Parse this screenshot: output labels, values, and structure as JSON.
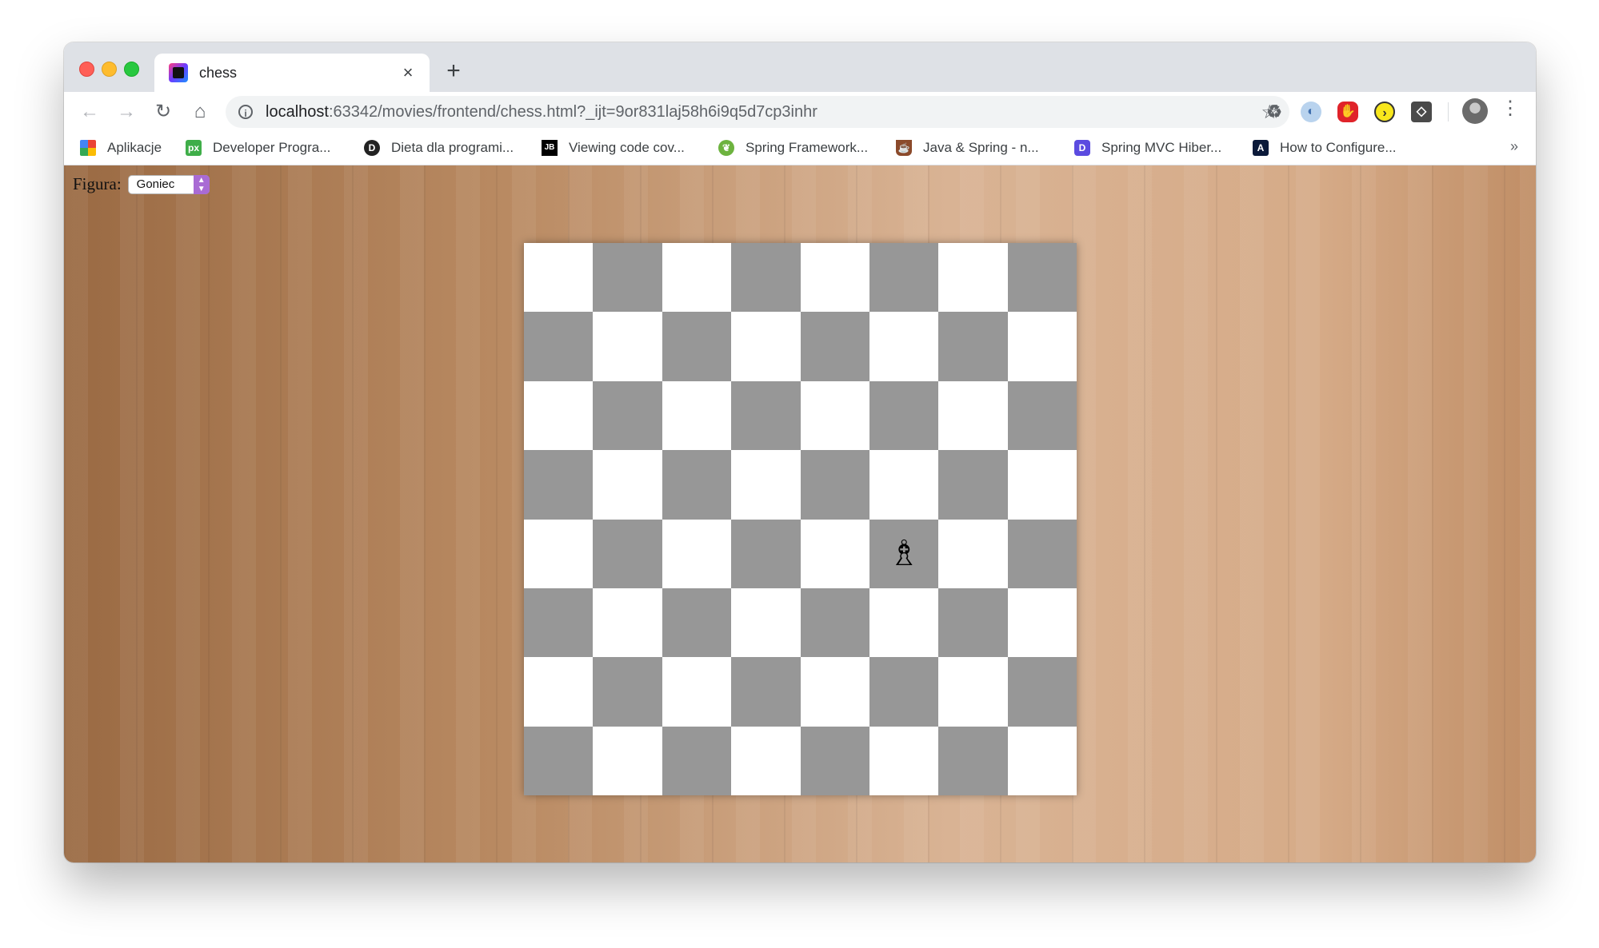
{
  "browser": {
    "tab": {
      "title": "chess",
      "close": "×"
    },
    "new_tab": "+",
    "nav": {
      "back": "←",
      "forward": "→",
      "reload": "↻",
      "home": "⌂"
    },
    "url": {
      "host": "localhost",
      "rest": ":63342/movies/frontend/chess.html?_ijt=9or831laj58h6i9q5d7cp3inhr"
    },
    "bookmarks": [
      {
        "label": "Aplikacje",
        "icon": "apps-grid-icon"
      },
      {
        "label": "Developer Progra...",
        "icon": "px-icon"
      },
      {
        "label": "Dieta dla programi...",
        "icon": "d-icon"
      },
      {
        "label": "Viewing code cov...",
        "icon": "jb-icon"
      },
      {
        "label": "Spring Framework...",
        "icon": "spring-leaf-icon"
      },
      {
        "label": "Java & Spring - n...",
        "icon": "coffee-cup-icon"
      },
      {
        "label": "Spring MVC Hiber...",
        "icon": "dbeaver-d-icon"
      },
      {
        "label": "How to Configure...",
        "icon": "a-logo-icon"
      }
    ],
    "bookmarks_more": "»"
  },
  "page": {
    "picker_label": "Figura:",
    "selected_piece": "Goniec",
    "board": {
      "size": 8,
      "pieces": [
        {
          "row": 4,
          "col": 5,
          "glyph": "♗",
          "name": "bishop"
        }
      ]
    }
  }
}
